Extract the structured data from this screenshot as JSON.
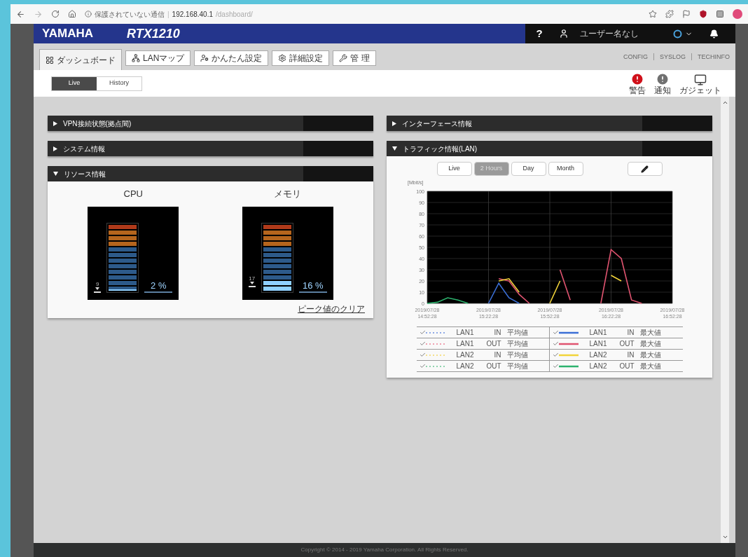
{
  "browser": {
    "security_label": "保護されていない通信",
    "separator": "|",
    "host": "192.168.40.1",
    "path": "/dashboard/"
  },
  "header": {
    "brand": "YAMAHA",
    "model": "RTX1210",
    "help": "?",
    "user": "ユーザー名なし"
  },
  "nav_tabs": [
    {
      "label": "ダッシュボード",
      "selected": true,
      "kind": "grid"
    },
    {
      "label": "LANマップ",
      "selected": false,
      "kind": "map"
    },
    {
      "label": "かんたん設定",
      "selected": false,
      "kind": "person"
    },
    {
      "label": "詳細設定",
      "selected": false,
      "kind": "gear"
    },
    {
      "label": "管 理",
      "selected": false,
      "kind": "wrench"
    }
  ],
  "links": [
    "CONFIG",
    "SYSLOG",
    "TECHINFO"
  ],
  "view_toggle": [
    {
      "label": "Live",
      "selected": true
    },
    {
      "label": "History",
      "selected": false
    }
  ],
  "status_icons": [
    {
      "kind": "alert",
      "label": "警告"
    },
    {
      "kind": "notice",
      "label": "通知"
    },
    {
      "kind": "gadget",
      "label": "ガジェット"
    }
  ],
  "left_panels": [
    {
      "title": "VPN接続状態(拠点間)",
      "expanded": false,
      "kind": "vpn"
    },
    {
      "title": "システム情報",
      "expanded": false,
      "kind": "system"
    },
    {
      "title": "リソース情報",
      "expanded": true,
      "kind": "resources"
    }
  ],
  "resources": {
    "meters": [
      {
        "name": "CPU",
        "level": 0.02,
        "peak": "9",
        "reading": "2 %"
      },
      {
        "name": "メモリ",
        "level": 0.16,
        "peak": "17",
        "reading": "16 %"
      }
    ],
    "clear_link": "ピーク値のクリア"
  },
  "right_panels": [
    {
      "title": "インターフェース情報",
      "expanded": false,
      "kind": "interface"
    },
    {
      "title": "トラフィック情報(LAN)",
      "expanded": true,
      "kind": "traffic"
    }
  ],
  "traffic": {
    "ranges": [
      {
        "label": "Live",
        "selected": false
      },
      {
        "label": "2 Hours",
        "selected": true
      },
      {
        "label": "Day",
        "selected": false
      },
      {
        "label": "Month",
        "selected": false
      }
    ],
    "chart_data": {
      "type": "line",
      "ylabel": "[Mbit/s]",
      "categories": [
        "2019/07/28 14:52:28",
        null,
        null,
        null,
        null,
        null,
        "2019/07/28 15:22:28",
        null,
        null,
        null,
        null,
        null,
        "2019/07/28 15:52:28",
        null,
        null,
        null,
        null,
        null,
        "2019/07/28 16:22:28",
        null,
        null,
        null,
        null,
        null,
        "2019/07/28 16:52:28"
      ],
      "ylim": [
        0,
        100
      ],
      "yticks": [
        0,
        10,
        20,
        30,
        40,
        50,
        60,
        70,
        80,
        90,
        100
      ],
      "grid": true,
      "series": [
        {
          "color": "#3b6fd6",
          "values": [
            null,
            null,
            null,
            null,
            null,
            null,
            0,
            18,
            5,
            0,
            null,
            null,
            null,
            null,
            null,
            null,
            null,
            null,
            null,
            null,
            null,
            null,
            null,
            null,
            null
          ]
        },
        {
          "color": "#e05470",
          "values": [
            null,
            null,
            null,
            null,
            null,
            null,
            null,
            22,
            20,
            8,
            0,
            null,
            null,
            30,
            3,
            null,
            null,
            0,
            48,
            40,
            3,
            0,
            null,
            null,
            null
          ]
        },
        {
          "color": "#f2d43a",
          "values": [
            null,
            null,
            null,
            null,
            null,
            null,
            null,
            20,
            22,
            10,
            null,
            null,
            0,
            20,
            null,
            null,
            null,
            null,
            25,
            20,
            null,
            null,
            null,
            null,
            null
          ]
        },
        {
          "color": "#2db36e",
          "values": [
            0,
            1,
            5,
            3,
            0,
            null,
            null,
            null,
            null,
            null,
            null,
            null,
            null,
            null,
            null,
            null,
            null,
            null,
            null,
            null,
            null,
            null,
            null,
            null,
            null
          ]
        }
      ]
    },
    "legend": [
      {
        "checked": true,
        "kind": "dotted",
        "color": "#8fa9e6",
        "interface": "LAN1",
        "direction": "IN",
        "statistic": "平均値"
      },
      {
        "checked": true,
        "kind": "solid",
        "color": "#3b6fd6",
        "interface": "LAN1",
        "direction": "IN",
        "statistic": "最大値"
      },
      {
        "checked": true,
        "kind": "dotted",
        "color": "#f0a0b0",
        "interface": "LAN1",
        "direction": "OUT",
        "statistic": "平均値"
      },
      {
        "checked": true,
        "kind": "solid",
        "color": "#e05470",
        "interface": "LAN1",
        "direction": "OUT",
        "statistic": "最大値"
      },
      {
        "checked": true,
        "kind": "dotted",
        "color": "#f5e08a",
        "interface": "LAN2",
        "direction": "IN",
        "statistic": "平均値"
      },
      {
        "checked": true,
        "kind": "solid",
        "color": "#f2d43a",
        "interface": "LAN2",
        "direction": "IN",
        "statistic": "最大値"
      },
      {
        "checked": true,
        "kind": "dotted",
        "color": "#8fd3ad",
        "interface": "LAN2",
        "direction": "OUT",
        "statistic": "平均値"
      },
      {
        "checked": true,
        "kind": "solid",
        "color": "#2db36e",
        "interface": "LAN2",
        "direction": "OUT",
        "statistic": "最大値"
      }
    ]
  },
  "footer": "Copyright © 2014 - 2019 Yamaha Corporation. All Rights Reserved."
}
